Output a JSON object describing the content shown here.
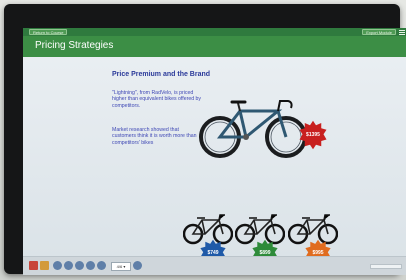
{
  "window": {
    "top_left_button": "Return to Course",
    "top_right_button": "Export Module",
    "header_title": "Pricing Strategies"
  },
  "slide": {
    "title": "Price Premium and the Brand",
    "paragraph1": "\"Lightning\", from RadVelo, is priced higher than equivalent bikes offered by competitors.",
    "paragraph2": "Market research showed that customers think it is worth more than competitors' bikes"
  },
  "prices": {
    "main": "$1395",
    "comp1": "$749",
    "comp2": "$899",
    "comp3": "$995"
  },
  "bottom": {
    "page_counter": "4/6 ▾"
  },
  "colors": {
    "header_green": "#3c8e45",
    "badge_red": "#c8201f",
    "badge_blue": "#1f5aa8",
    "badge_green": "#2e8b3a",
    "badge_orange": "#e06c1f",
    "title_blue": "#2b3a9a"
  },
  "icons": [
    "menu-icon",
    "play-icon",
    "rewind-icon",
    "volume-icon",
    "captions-icon",
    "settings-icon"
  ]
}
